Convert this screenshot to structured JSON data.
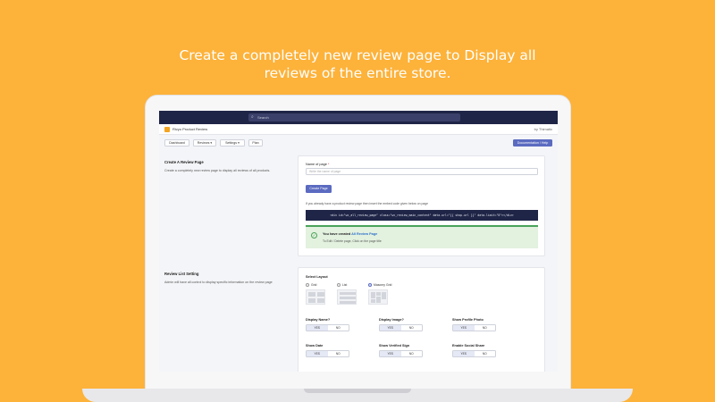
{
  "headline": {
    "line1": "Create a completely new review page to Display all",
    "line2": "reviews of the entire store."
  },
  "app": {
    "search_placeholder": "Search",
    "title": "Rivyo Product Review",
    "by": "by Thimatic",
    "nav": [
      "Dashboard",
      "Reviews ▾",
      "Settings ▾",
      "Plan"
    ],
    "doc_button": "Documentation / Help"
  },
  "create_section": {
    "heading": "Create A Review Page",
    "description": "Create a completely new review page to display all reviews of all products.",
    "field_label": "Name of page",
    "required_mark": "*",
    "field_placeholder": "Write the name of page",
    "create_button": "Create Page",
    "embed_help": "If you already have a product review page then insert the embed code given below on page",
    "embed_code": "<div id=\"wc_all_review_page\" class=\"wc_review_main_content\" data-url=\"{{ shop.url }}\" data-limit=\"8\"></div>",
    "success_prefix": "You have created ",
    "success_link": "All Review Page",
    "success_sub": "To Edit / Delete page, Click on the page title"
  },
  "list_section": {
    "heading": "Review List Setting",
    "description": "Admin will have all control to display specific information on the review page",
    "layout_label": "Select Layout",
    "layouts": [
      {
        "label": "Grid",
        "selected": false
      },
      {
        "label": "List",
        "selected": false
      },
      {
        "label": "Masonry Grid",
        "selected": true
      }
    ],
    "options": [
      {
        "label": "Display Name?",
        "yes": "YES",
        "no": "NO",
        "value": "yes"
      },
      {
        "label": "Display Image?",
        "yes": "YES",
        "no": "NO",
        "value": "yes"
      },
      {
        "label": "Show Profile Photo",
        "yes": "YES",
        "no": "NO",
        "value": "yes"
      },
      {
        "label": "Show Date",
        "yes": "YES",
        "no": "NO",
        "value": "yes"
      },
      {
        "label": "Show Verified Sign",
        "yes": "YES",
        "no": "NO",
        "value": "yes"
      },
      {
        "label": "Enable Social Share",
        "yes": "YES",
        "no": "NO",
        "value": "yes"
      }
    ]
  },
  "colors": {
    "background": "#FDB23A",
    "topbar": "#1f2547",
    "accent": "#5b6bc0",
    "success": "#4aa35a"
  }
}
